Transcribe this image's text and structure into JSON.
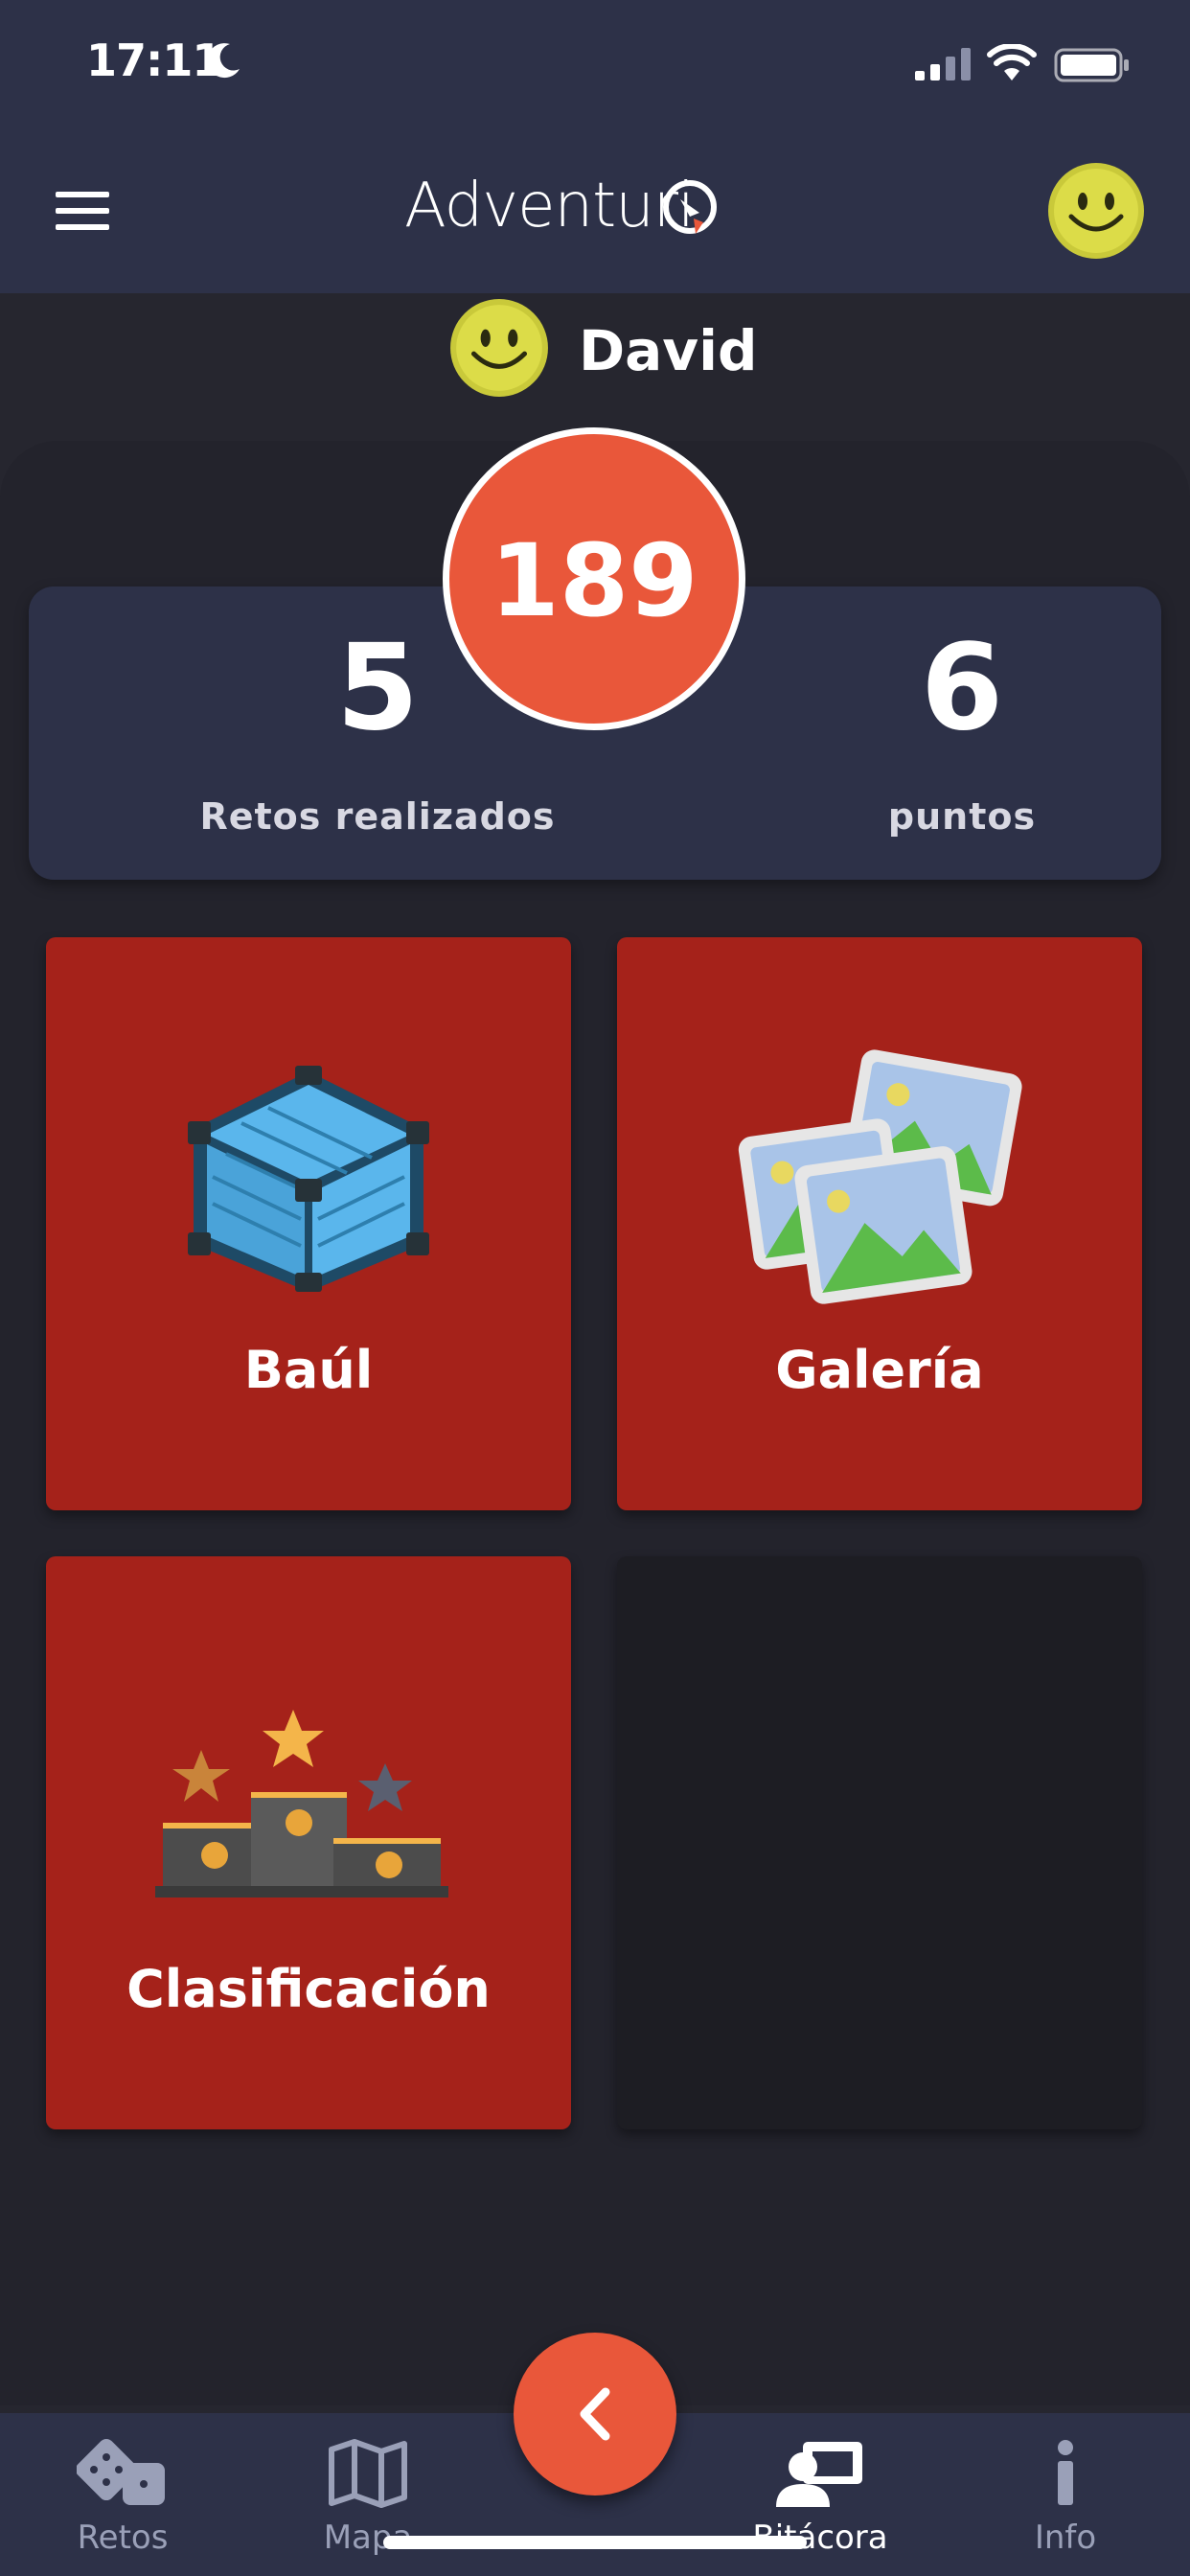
{
  "status_bar": {
    "time": "17:11"
  },
  "header": {
    "app_name": "Adventuri"
  },
  "user": {
    "name": "David"
  },
  "stats": {
    "score": "189",
    "challenges_count": "5",
    "challenges_label": "Retos realizados",
    "points_count": "6",
    "points_label": "puntos"
  },
  "tiles": [
    {
      "label": "Baúl"
    },
    {
      "label": "Galería"
    },
    {
      "label": "Clasificación"
    }
  ],
  "tabs": [
    {
      "label": "Retos"
    },
    {
      "label": "Mapa"
    },
    {
      "label": "Bitácora"
    },
    {
      "label": "Info"
    }
  ],
  "colors": {
    "bar": "#2d3148",
    "accent": "#e9573a",
    "tile": "#a5221a"
  }
}
